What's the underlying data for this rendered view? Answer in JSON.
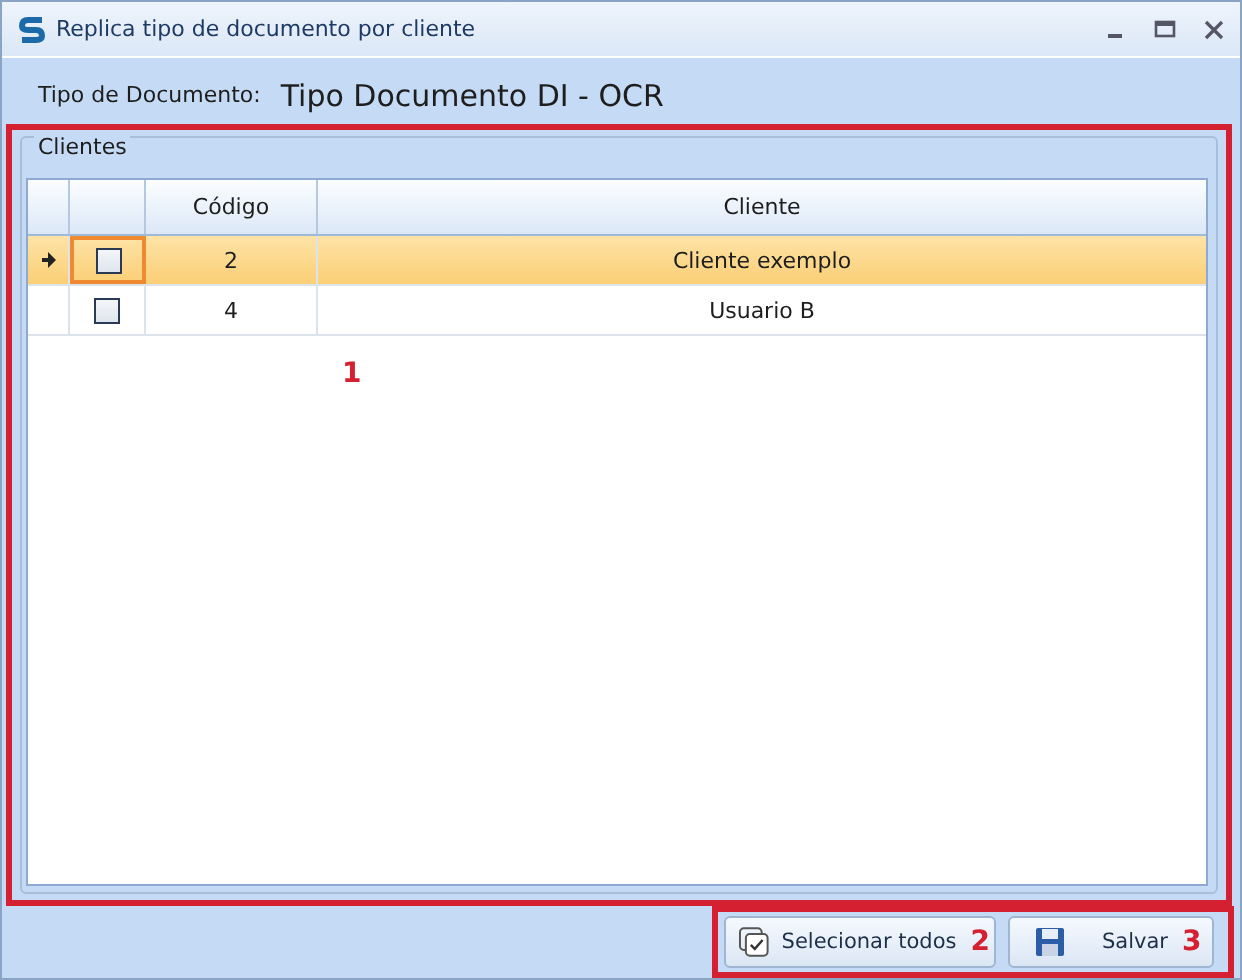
{
  "window": {
    "title": "Replica tipo de documento por cliente"
  },
  "document_type": {
    "label": "Tipo de Documento:",
    "value": "Tipo Documento DI - OCR"
  },
  "group": {
    "title": "Clientes"
  },
  "table": {
    "columns": [
      "Código",
      "Cliente"
    ],
    "rows": [
      {
        "current": true,
        "selected": true,
        "checked": false,
        "code": "2",
        "client": "Cliente exemplo"
      },
      {
        "current": false,
        "selected": false,
        "checked": false,
        "code": "4",
        "client": "Usuario B"
      }
    ]
  },
  "buttons": [
    {
      "kind": "select-all",
      "label": "Selecionar todos"
    },
    {
      "kind": "save",
      "label": "Salvar"
    }
  ],
  "annotations": [
    {
      "number": "1"
    },
    {
      "number": "2"
    },
    {
      "number": "3"
    }
  ]
}
